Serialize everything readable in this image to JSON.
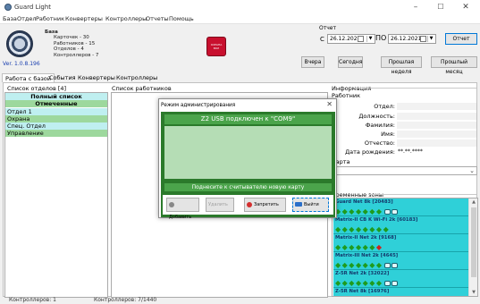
{
  "window": {
    "title": "Guard Light"
  },
  "menu": [
    "База",
    "Отдел",
    "Работник",
    "Конвертеры",
    "Контроллеры",
    "Отчеты",
    "Помощь"
  ],
  "header": {
    "version": "Ver. 1.0.8.196",
    "stats": {
      "db": "База",
      "cards": "Карточек - 30",
      "workers": "Работников - 15",
      "depts": "Отделов - 4",
      "controllers": "Контроллеров - 7"
    },
    "alarm_text": "ОХРАНА ВКЛ",
    "report": {
      "label": "Отчет",
      "from": "С",
      "to": "ПО",
      "date_from": "26.12.2021",
      "date_to": "26.12.2021",
      "report_button": "Отчет",
      "yesterday": "Вчера",
      "today": "Сегодня",
      "last_week": "Прошлая неделя",
      "last_month": "Прошлый месяц"
    }
  },
  "tabs": [
    "Работа с базой",
    "События",
    "Конвертеры",
    "Контроллеры"
  ],
  "departments": {
    "label": "Список отделов [4]",
    "full_list": "Полный список",
    "marked": "Отмеченные",
    "items": [
      "Отдел 1",
      "Охрана",
      "Спец. Отдел",
      "Управление"
    ]
  },
  "employees": {
    "label": "Список работников"
  },
  "info": {
    "label": "Информация",
    "worker": "Работник",
    "rows": [
      {
        "label": "Отдел:",
        "value": ""
      },
      {
        "label": "Должность:",
        "value": ""
      },
      {
        "label": "Фамилия:",
        "value": ""
      },
      {
        "label": "Имя:",
        "value": ""
      },
      {
        "label": "Отчество:",
        "value": ""
      },
      {
        "label": "Дата рождения:",
        "value": "**.**.****"
      }
    ],
    "map_label": "Карта",
    "time_zones_label": "Временные зоны",
    "time_zones": [
      "Guard Net 8k [20483]",
      "Matrix-II CB K Wi-Fi 2k [60183]",
      "Matrix-II Net 2k [9168]",
      "Matrix-III Net 2k [4645]",
      "Z-5R Net 2k [32022]",
      "Z-5R Net 8k [16976]"
    ]
  },
  "statusbar": {
    "left": "Контроллеров: 1",
    "right": "Контроллеров: 7/1440"
  },
  "dialog": {
    "title": "Режим администрирования",
    "status": "Z2 USB подключен к \"COM9\"",
    "hint": "Поднесите к считывателю новую карту",
    "buttons": {
      "add": "Добавить",
      "delete": "Удалить",
      "ban": "Запретить",
      "exit": "Выйти"
    }
  }
}
